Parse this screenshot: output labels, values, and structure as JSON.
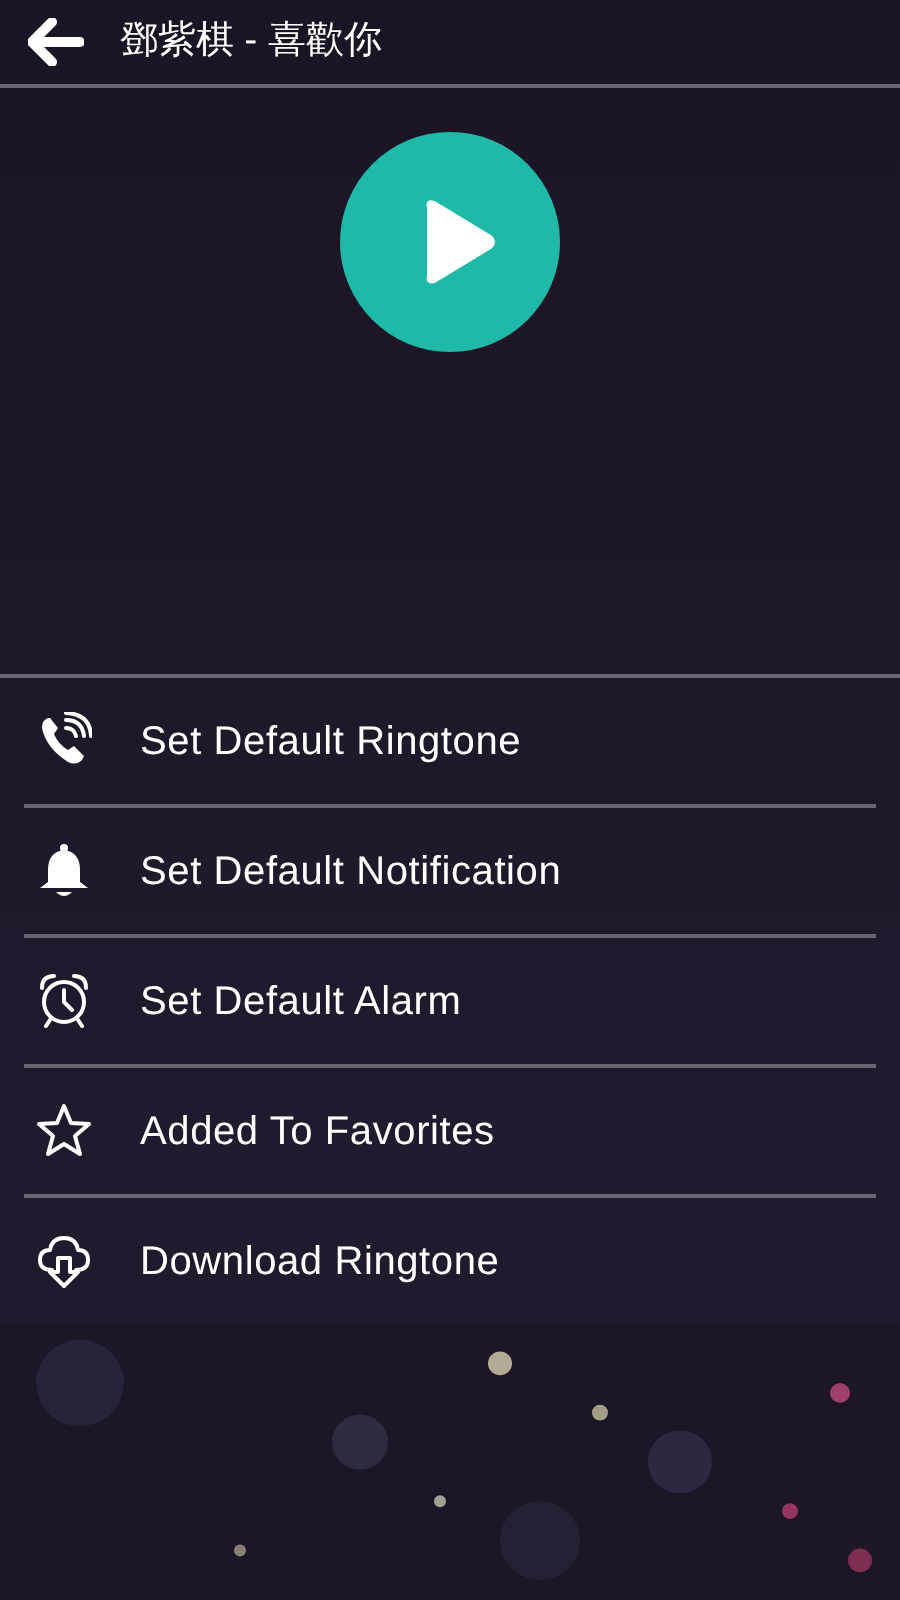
{
  "header": {
    "title": "鄧紫棋 - 喜歡你"
  },
  "menu": [
    {
      "label": "Set Default Ringtone"
    },
    {
      "label": "Set Default Notification"
    },
    {
      "label": "Set Default Alarm"
    },
    {
      "label": "Added To Favorites"
    },
    {
      "label": "Download Ringtone"
    }
  ]
}
